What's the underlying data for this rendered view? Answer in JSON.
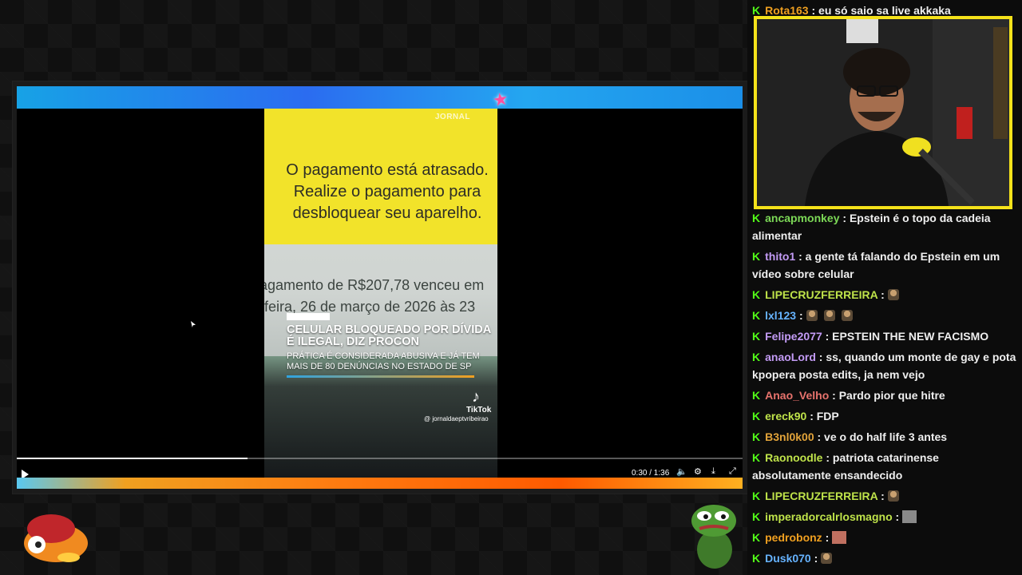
{
  "player": {
    "clip": {
      "watermark": "JORNAL",
      "message": "O pagamento está atrasado. Realize o pagamento para desbloquear seu aparelho.",
      "due_line1": "agamento de R$207,78 venceu em",
      "due_line2": "-feira, 26 de março de 2026 às 23",
      "headline": "Celular bloqueado por dívida é ilegal, diz Procon",
      "subheadline": "Prática é considerada abusiva e já tem mais de 80 denúncias no estado de SP",
      "tiktok_brand": "TikTok",
      "tiktok_handle": "@ jornaldaeptvribeirao"
    },
    "time": "0:30 / 1:36",
    "progress_fraction": 0.318
  },
  "chat": {
    "top_message": {
      "user": "Rota163",
      "text": ": eu só saio sa live akkaka",
      "color": "#f0a020"
    },
    "messages": [
      {
        "user": "ancapmonkey",
        "text": ": Epstein é o topo da cadeia alimentar",
        "color": "#7cd957"
      },
      {
        "user": "thito1",
        "text": ": a gente tá falando do Epstein em um vídeo sobre celular",
        "color": "#c39bf5"
      },
      {
        "user": "LIPECRUZFERREIRA",
        "text": ":",
        "color": "#bfe34a"
      },
      {
        "user": "lxl123",
        "text": ":",
        "color": "#66b3ff"
      },
      {
        "user": "Felipe2077",
        "text": ": EPSTEIN THE NEW FACISMO",
        "color": "#c39bf5"
      },
      {
        "user": "anaoLord",
        "text": ": ss, quando um monte de gay e pota kpopera posta edits, ja nem vejo",
        "color": "#c39bf5"
      },
      {
        "user": "Anao_Velho",
        "text": ": Pardo pior que hitre",
        "color": "#e8736d"
      },
      {
        "user": "ereck90",
        "text": ": FDP",
        "color": "#bfe34a"
      },
      {
        "user": "B3nl0k00",
        "text": ": ve o do half life 3 antes",
        "color": "#e3a43a"
      },
      {
        "user": "Raonoodle",
        "text": ": patriota catarinense absolutamente ensandecido",
        "color": "#bfe34a"
      },
      {
        "user": "LIPECRUZFERREIRA",
        "text": ":",
        "color": "#bfe34a"
      },
      {
        "user": "imperadorcalrlosmagno",
        "text": ":",
        "color": "#bfe34a"
      },
      {
        "user": "pedrobonz",
        "text": ":",
        "color": "#f0a020"
      },
      {
        "user": "Dusk070",
        "text": ":",
        "color": "#66b3ff"
      }
    ]
  },
  "colors": {
    "kick_green": "#53fc18",
    "cam_border": "#f5e21a"
  }
}
